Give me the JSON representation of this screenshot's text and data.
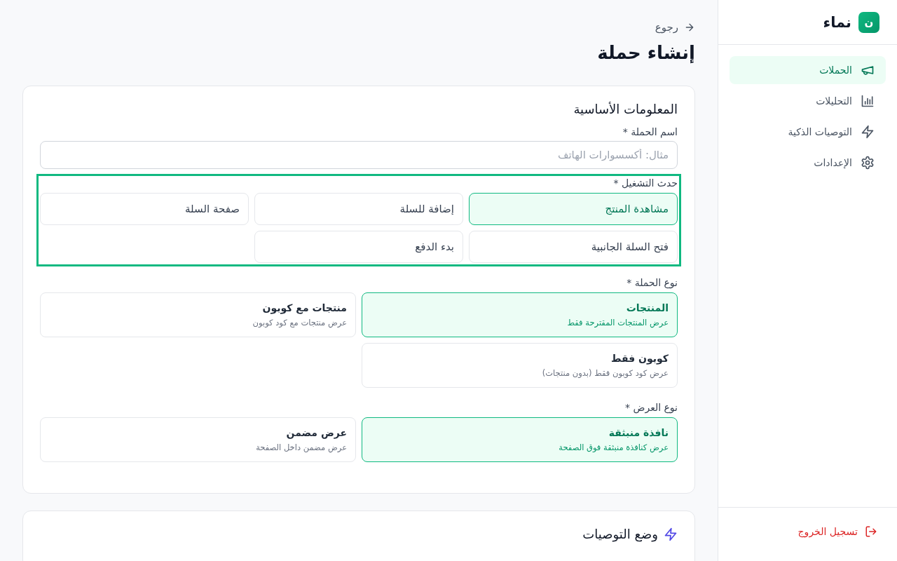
{
  "sidebar": {
    "logo_letter": "ن",
    "brand": "نماء",
    "items": [
      {
        "label": "الحملات",
        "selected": true
      },
      {
        "label": "التحليلات",
        "selected": false
      },
      {
        "label": "التوصيات الذكية",
        "selected": false
      },
      {
        "label": "الإعدادات",
        "selected": false
      }
    ],
    "logout": "تسجيل الخروج"
  },
  "back_link": "رجوع",
  "page_title": "إنشاء حملة",
  "sections": [
    {
      "title": "المعلومات الأساسية",
      "name_field": {
        "label": "اسم الحملة *",
        "placeholder": "مثال: أكسسوارات الهاتف"
      },
      "trigger": {
        "label": "حدث التشغيل *",
        "focused": true,
        "options": [
          {
            "label": "مشاهدة المنتج",
            "selected": true
          },
          {
            "label": "إضافة للسلة",
            "selected": false
          },
          {
            "label": "صفحة السلة",
            "selected": false
          },
          {
            "label": "فتح السلة الجانبية",
            "selected": false
          },
          {
            "label": "بدء الدفع",
            "selected": false
          }
        ]
      },
      "campaign_type": {
        "label": "نوع الحملة *",
        "options": [
          {
            "title": "المنتجات",
            "description": "عرض المنتجات المقترحة فقط",
            "selected": true
          },
          {
            "title": "منتجات مع كوبون",
            "description": "عرض منتجات مع كود كوبون",
            "selected": false
          },
          {
            "title": "كوبون فقط",
            "description": "عرض كود كوبون فقط (بدون منتجات)",
            "selected": false
          }
        ]
      },
      "display_type": {
        "label": "نوع العرض *",
        "options": [
          {
            "title": "نافذة منبثقة",
            "description": "عرض كنافذة منبثقة فوق الصفحة",
            "selected": true
          },
          {
            "title": "عرض مضمن",
            "description": "عرض مضمن داخل الصفحة",
            "selected": false
          }
        ]
      }
    },
    {
      "title": "وضع التوصيات"
    }
  ]
}
